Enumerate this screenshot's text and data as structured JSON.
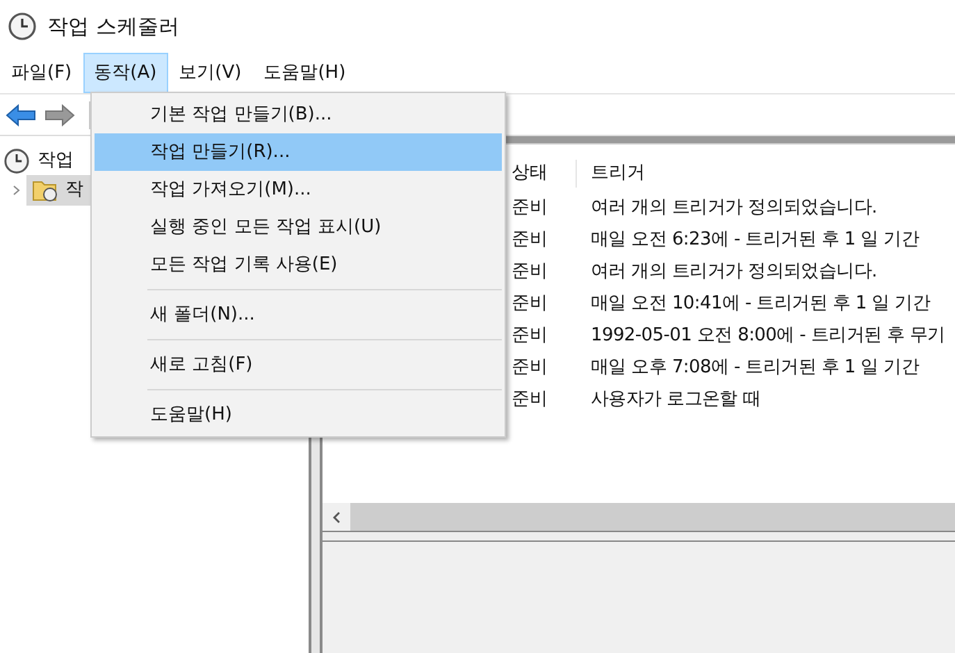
{
  "window": {
    "title": "작업 스케줄러"
  },
  "menu_bar": [
    {
      "label": "파일(F)",
      "selected": false
    },
    {
      "label": "동작(A)",
      "selected": true
    },
    {
      "label": "보기(V)",
      "selected": false
    },
    {
      "label": "도움말(H)",
      "selected": false
    }
  ],
  "tree": [
    {
      "label": "작업",
      "selected": false,
      "children": [
        {
          "label": "작",
          "selected": true
        }
      ]
    }
  ],
  "table": {
    "columns": [
      "상태",
      "트리거"
    ],
    "rows": [
      [
        "준비",
        "여러 개의 트리거가 정의되었습니다."
      ],
      [
        "준비",
        "매일 오전 6:23에 - 트리거된 후 1 일 기간"
      ],
      [
        "준비",
        "여러 개의 트리거가 정의되었습니다."
      ],
      [
        "준비",
        "매일 오전 10:41에 - 트리거된 후 1 일 기간"
      ],
      [
        "준비",
        "1992-05-01 오전 8:00에 - 트리거된 후 무기"
      ],
      [
        "준비",
        "매일 오후 7:08에 - 트리거된 후 1 일 기간"
      ],
      [
        "준비",
        "사용자가 로그온할 때"
      ]
    ]
  },
  "dropdown": [
    {
      "kind": "item",
      "label": "기본 작업 만들기(B)...",
      "selected": false
    },
    {
      "kind": "item",
      "label": "작업 만들기(R)...",
      "selected": true
    },
    {
      "kind": "item",
      "label": "작업 가져오기(M)...",
      "selected": false
    },
    {
      "kind": "item",
      "label": "실행 중인 모든 작업 표시(U)",
      "selected": false
    },
    {
      "kind": "item",
      "label": "모든 작업 기록 사용(E)",
      "selected": false
    },
    {
      "kind": "separator"
    },
    {
      "kind": "item",
      "label": "새 폴더(N)...",
      "selected": false
    },
    {
      "kind": "separator"
    },
    {
      "kind": "item",
      "label": "새로 고침(F)",
      "selected": false
    },
    {
      "kind": "separator"
    },
    {
      "kind": "item",
      "label": "도움말(H)",
      "selected": false
    }
  ]
}
